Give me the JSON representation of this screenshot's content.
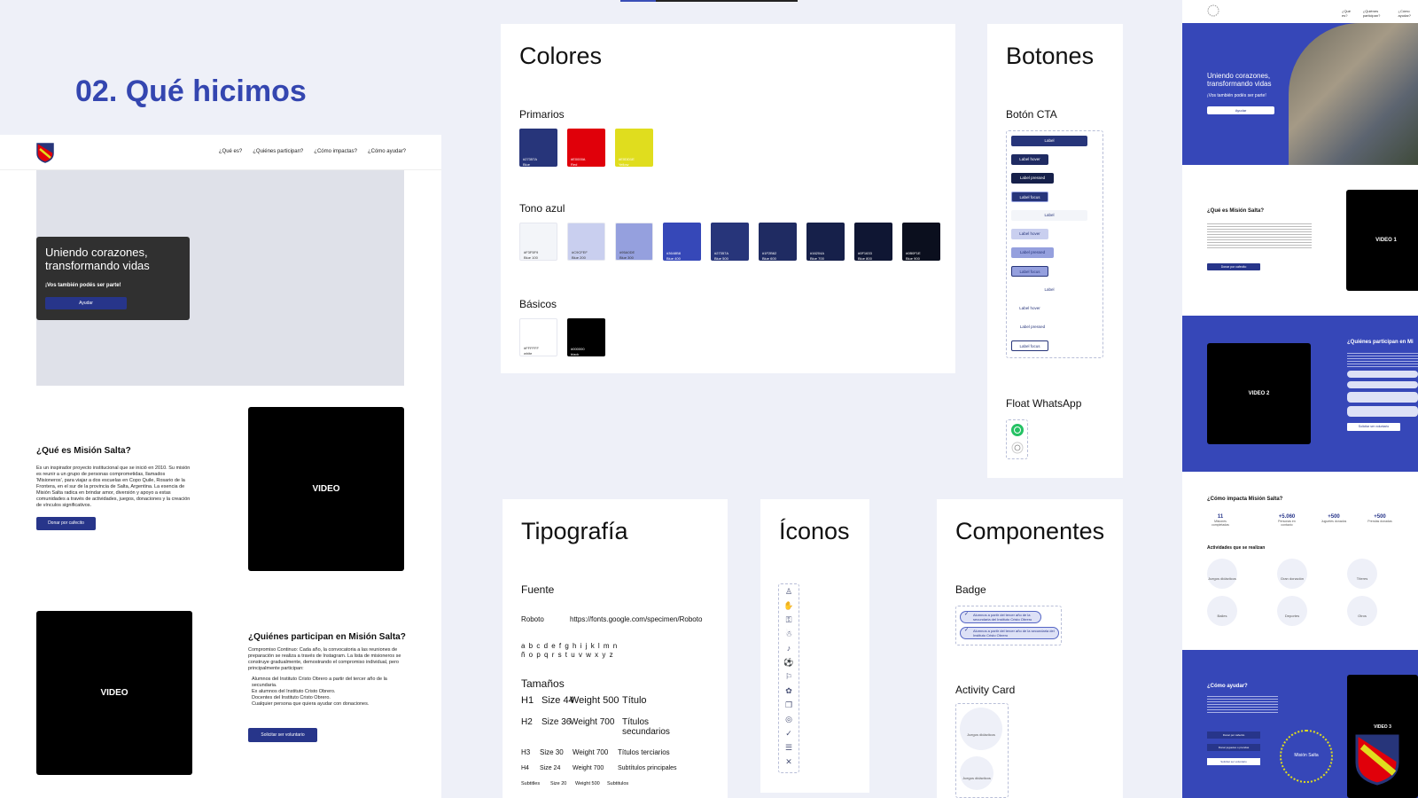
{
  "section_title": "02. Qué hicimos",
  "mock": {
    "nav": [
      "¿Qué es?",
      "¿Quiénes participan?",
      "¿Cómo impactas?",
      "¿Cómo ayudar?"
    ],
    "hero_title": "Uniendo corazones, transformando vidas",
    "hero_sub": "¡Vos también podés ser parte!",
    "hero_btn": "Ayudar",
    "about_title": "¿Qué es Misión Salta?",
    "about_text": "Es un inspirador proyecto institucional que se inició en 2010. Su misión es reunir a un grupo de personas comprometidas, llamados 'Misioneros', para viajar a dos escuelas en Copo Quile, Rosario de la Frontera, en el sur de la provincia de Salta, Argentina. La esencia de Misión Salta radica en brindar amor, diversión y apoyo a estas comunidades a través de actividades, juegos, donaciones y la creación de vínculos significativos.",
    "about_btn": "Donar por cafecito",
    "video1": "VIDEO",
    "video2": "VIDEO",
    "who_title": "¿Quiénes participan en Misión Salta?",
    "who_text": "Compromiso Continuo: Cada año, la convocatoria a las reuniones de preparación se realiza a través de Instagram. La lista de misioneros se construye gradualmente, demostrando el compromiso individual, pero principalmente participan:",
    "who_list": [
      "Alumnos del Instituto Cristo Obrero a partir del tercer año de la secundaria.",
      "Ex alumnos del Instituto Cristo Obrero.",
      "Docentes del Instituto Cristo Obrero.",
      "Cualquier persona que quiera ayudar con donaciones."
    ],
    "who_btn": "Solicitar ser voluntario"
  },
  "colores": {
    "title": "Colores",
    "primarios_label": "Primarios",
    "primarios": [
      {
        "hex": "#27357A",
        "name": "Blue",
        "color": "#27357a"
      },
      {
        "hex": "#E0000A",
        "name": "Red",
        "color": "#e0000a"
      },
      {
        "hex": "#E0DD1E",
        "name": "Yellow",
        "color": "#e0dd1e"
      }
    ],
    "azul_label": "Tono azul",
    "azul": [
      {
        "hex": "#F3F5F9",
        "name": "Blue 100",
        "color": "#f3f5f9",
        "dark": true
      },
      {
        "hex": "#C9CFEF",
        "name": "Blue 200",
        "color": "#c9cfef",
        "dark": true
      },
      {
        "hex": "#95A0DE",
        "name": "Blue 300",
        "color": "#95a0de",
        "dark": true
      },
      {
        "hex": "#3648B8",
        "name": "Blue 400",
        "color": "#3648b8"
      },
      {
        "hex": "#27357A",
        "name": "Blue 500",
        "color": "#27357a"
      },
      {
        "hex": "#1F2B62",
        "name": "Blue 600",
        "color": "#1f2b62"
      },
      {
        "hex": "#16204A",
        "name": "Blue 700",
        "color": "#16204a"
      },
      {
        "hex": "#0F1633",
        "name": "Blue 800",
        "color": "#0f1633"
      },
      {
        "hex": "#0B0F1E",
        "name": "Blue 900",
        "color": "#0b0f1e"
      }
    ],
    "basicos_label": "Básicos",
    "basicos": [
      {
        "hex": "#FFFFFF",
        "name": "white",
        "color": "#ffffff",
        "dark": true
      },
      {
        "hex": "#000000",
        "name": "black",
        "color": "#000000"
      }
    ]
  },
  "botones": {
    "title": "Botones",
    "cta_label": "Botón CTA",
    "buttons": [
      "Label",
      "Label hover",
      "Label pressed",
      "Label focus",
      "Label",
      "Label hover",
      "Label pressed",
      "Label focus",
      "Label",
      "Label hover",
      "Label pressed",
      "Label focus"
    ],
    "whatsapp_label": "Float WhatsApp"
  },
  "tipografia": {
    "title": "Tipografía",
    "fuente_label": "Fuente",
    "font_name": "Roboto",
    "font_url": "https://fonts.google.com/specimen/Roboto",
    "alphabet1": "a b c d e f g h i j k l m n",
    "alphabet2": "ñ o p q r s t u v w x y z",
    "tamanos_label": "Tamaños",
    "rows": [
      {
        "tag": "H1",
        "size": "Size 44",
        "weight": "Weight 500",
        "use": "Título"
      },
      {
        "tag": "H2",
        "size": "Size 36",
        "weight": "Weight 700",
        "use": "Títulos secundarios"
      },
      {
        "tag": "H3",
        "size": "Size 30",
        "weight": "Weight 700",
        "use": "Títulos terciarios"
      },
      {
        "tag": "H4",
        "size": "Size 24",
        "weight": "Weight 700",
        "use": "Subtítulos principales"
      },
      {
        "tag": "Subtitles",
        "size": "Size 20",
        "weight": "Weight 500",
        "use": "Subtitulos"
      }
    ]
  },
  "iconos": {
    "title": "Íconos"
  },
  "componentes": {
    "title": "Componentes",
    "badge_label": "Badge",
    "badge1": "Alumnos a partir del tercer año de la secundaria del Instituto Cristo Obrero",
    "badge2": "Alumnos a partir del tercer año de la secundaria del Instituto Cristo Obrero",
    "activity_label": "Activity Card",
    "activity1": "Juegos didácticos",
    "activity2": "Juegos didácticos"
  },
  "right": {
    "nav": [
      "¿Qué es?",
      "¿Quiénes participan?",
      "¿Cómo ayudar?"
    ],
    "hero_title": "Uniendo corazones, transformando vidas",
    "hero_sub": "¡Vos también podés ser parte!",
    "hero_btn": "Ayudar",
    "about_title": "¿Qué es Misión Salta?",
    "about_btn": "Donar por cafecito",
    "video1": "VIDEO 1",
    "video2": "VIDEO 2",
    "who_title": "¿Quiénes participan en Mi",
    "who_btn": "Solicitar ser voluntario",
    "impact_title": "¿Cómo impacta Misión Salta?",
    "stats": [
      {
        "value": "11",
        "label": "Misiones completadas"
      },
      {
        "value": "+5.060",
        "label": "Personas en contacto"
      },
      {
        "value": "+500",
        "label": "Juguetes donados"
      },
      {
        "value": "+500",
        "label": "Prendas donadas"
      }
    ],
    "activities_title": "Actividades que se realizan",
    "activities": [
      "Juegos didácticos",
      "Gran donación",
      "Títeres",
      "Bailes",
      "Deportes",
      "Otros"
    ],
    "help_title": "¿Cómo ayudar?",
    "help_btns": [
      "Donar por cafecito",
      "Donar juguetes o prendas",
      "Solicitar ser voluntario"
    ],
    "video3": "VIDEO 3",
    "seal": "Misión Salta"
  }
}
